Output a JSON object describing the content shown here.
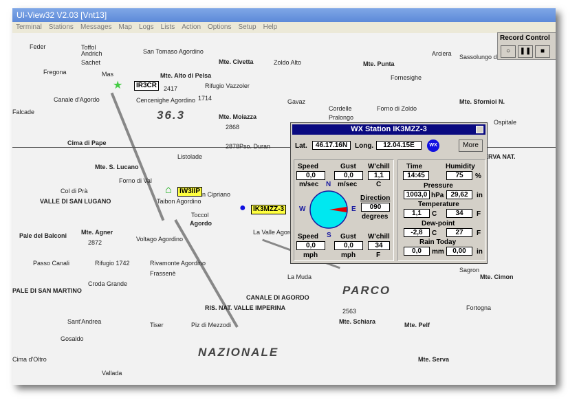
{
  "window": {
    "title": "UI-View32 V2.03 [Vnt13]"
  },
  "menu": [
    "Terminal",
    "Stations",
    "Messages",
    "Map",
    "Logs",
    "Lists",
    "Action",
    "Options",
    "Setup",
    "Help"
  ],
  "record_control": {
    "title": "Record Control",
    "buttons": [
      "record",
      "pause",
      "stop"
    ]
  },
  "map": {
    "labels": [
      "Agordo",
      "Cencenighe Agordino",
      "Canale d'Agordo",
      "Mte. Alto di Pelsa",
      "2417",
      "Rifugio Vazzoler",
      "1714",
      "Mte. Civetta",
      "Zoldo Alto",
      "Mte. Moiazza",
      "2868",
      "2878",
      "Pso. Duran",
      "36.3",
      "Listolade",
      "Cima di Pape",
      "Mte. S. Lucano",
      "Forno di Val",
      "VALLE DI SAN LUGANO",
      "Taibon Agordino",
      "Toccol",
      "San Cipriano",
      "La Valle Agordina",
      "Mte. Agner",
      "2872",
      "Voltago Agordino",
      "Rivamonte Agordino",
      "Croda Grande",
      "PALE DI SAN MARTINO",
      "Gosaldo",
      "Piz di Mezzodi",
      "Cima d'Oltro",
      "PARCO",
      "NAZIONALE",
      "Mte. Schiara",
      "2563",
      "Mte. Pelf",
      "Mte. Serva",
      "Forno di Zoldo",
      "Mte. Punta",
      "Fornesighe",
      "Sassolungo di Cibiana",
      "Mte. Sfornioi N.",
      "SERVA NAT.",
      "Mte. Cimon",
      "Sagron",
      "Fortogna",
      "RIS. NAT. VALLE IMPERINA",
      "CANALE DI AGORDO",
      "Frassenè",
      "San Tomaso Agordino",
      "Mas",
      "Vallada",
      "Sachet",
      "Fregona",
      "Andrich",
      "Toffol",
      "Feder",
      "Falcade",
      "Passo Canali",
      "Sant'Andrea",
      "Tiser",
      "La Muda",
      "Cordelle",
      "Pralongo",
      "Ospitale",
      "Gavaz",
      "Arciera",
      "Col di Prà",
      "Pale del Balconi",
      "Rifugio 1742"
    ],
    "stations": [
      "IR3CR",
      "IW3IIP",
      "IK3MZZ-3"
    ]
  },
  "wx": {
    "title": "WX Station  IK3MZZ-3",
    "lat_label": "Lat.",
    "lat": "46.17.16N",
    "long_label": "Long.",
    "long": "12.04.15E",
    "icon": "WX",
    "more": "More",
    "speed_label": "Speed",
    "gust_label": "Gust",
    "wchill_label": "W'chill",
    "speed_ms": "0,0",
    "gust_ms": "0,0",
    "wchill_c": "1,1",
    "unit_ms": "m/sec",
    "unit_c": "C",
    "compass": {
      "n": "N",
      "s": "S",
      "e": "E",
      "w": "W"
    },
    "direction_label": "Direction",
    "direction": "090",
    "degrees": "degrees",
    "speed_mph": "0,0",
    "gust_mph": "0,0",
    "wchill_f": "34",
    "unit_mph": "mph",
    "unit_f": "F",
    "time_label": "Time",
    "time": "14:45",
    "humidity_label": "Humidity",
    "humidity": "75",
    "pct": "%",
    "pressure_label": "Pressure",
    "pressure_hpa": "1003,0",
    "hpa": "hPa",
    "pressure_in": "29,62",
    "in": "in",
    "temp_label": "Temperature",
    "temp_c": "1,1",
    "temp_f": "34",
    "dew_label": "Dew-point",
    "dew_c": "-2,8",
    "dew_f": "27",
    "rain_label": "Rain Today",
    "rain_mm": "0,0",
    "mm": "mm",
    "rain_in": "0,00",
    "colors": {
      "titlebar": "#0a0a80",
      "compass": "#00e8f0",
      "needle": "#e00000"
    }
  }
}
